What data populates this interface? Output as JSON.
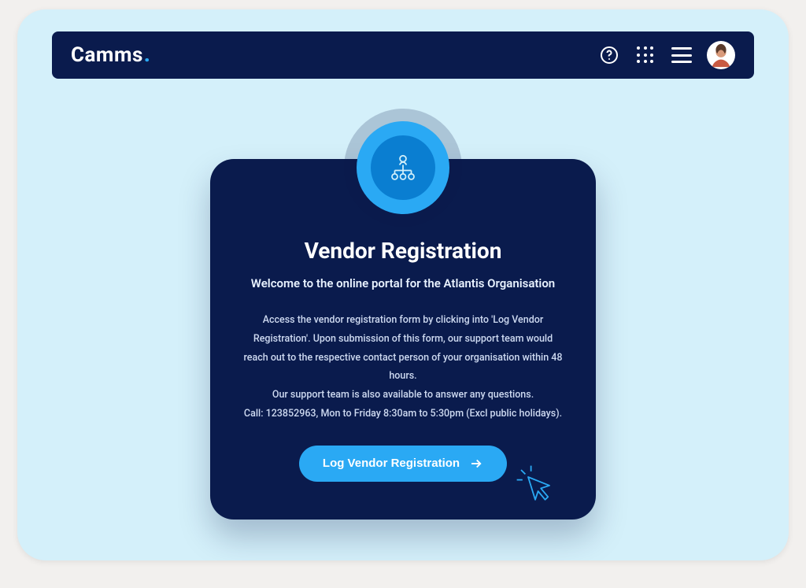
{
  "brand": {
    "name": "Camms",
    "dot": "."
  },
  "header_icons": {
    "help": "help-icon",
    "apps": "apps-grid-icon",
    "menu": "hamburger-menu-icon",
    "avatar": "user-avatar"
  },
  "card": {
    "title": "Vendor Registration",
    "subtitle": "Welcome to the online portal for the Atlantis Organisation",
    "body_line1": "Access the vendor registration form by clicking into 'Log Vendor Registration'. Upon submission of this form, our support team would reach out to the respective contact person of your organisation within 48 hours.",
    "body_line2": "Our support team is also available to answer any questions.",
    "body_line3": "Call: 123852963, Mon to Friday 8:30am to 5:30pm (Excl public holidays).",
    "cta_label": "Log Vendor Registration"
  },
  "colors": {
    "accent": "#2aa9f4",
    "navy": "#0a1b4d",
    "page_bg": "#d4f0fa"
  }
}
